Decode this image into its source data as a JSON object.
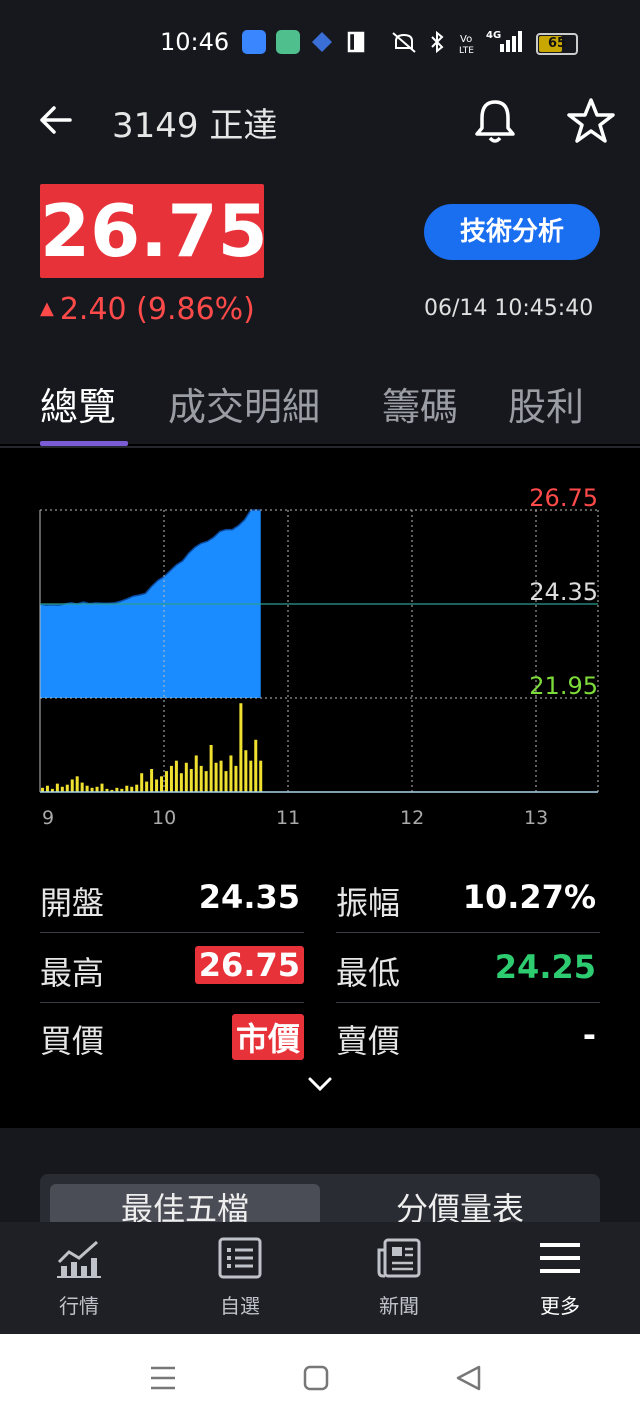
{
  "status_bar": {
    "time": "10:46",
    "battery": "65",
    "battery_level": 0.65,
    "icons": [
      "app-icon-android",
      "download-icon",
      "app-icon-diamond",
      "book-icon",
      "mute-icon",
      "bluetooth-icon",
      "volte-icon",
      "signal-4g-icon",
      "battery-icon"
    ]
  },
  "header": {
    "title": "3149 正達",
    "price": "26.75",
    "change": "2.40 (9.86%)",
    "change_arrow": "▲",
    "datetime": "06/14 10:45:40",
    "tech_button": "技術分析"
  },
  "tabs": [
    "總覽",
    "成交明細",
    "籌碼",
    "股利"
  ],
  "chart_data": {
    "type": "area",
    "y_labels": {
      "high": "26.75",
      "ref": "24.35",
      "low": "21.95"
    },
    "x_ticks": [
      "9",
      "10",
      "11",
      "12",
      "13"
    ],
    "ylim": [
      21.95,
      26.75
    ],
    "reference": 24.35,
    "price_series": {
      "x": [
        9.0,
        9.05,
        9.1,
        9.15,
        9.2,
        9.25,
        9.3,
        9.35,
        9.4,
        9.45,
        9.5,
        9.55,
        9.6,
        9.65,
        9.7,
        9.75,
        9.8,
        9.85,
        9.9,
        9.95,
        10.0,
        10.05,
        10.1,
        10.15,
        10.2,
        10.25,
        10.3,
        10.35,
        10.4,
        10.45,
        10.5,
        10.55,
        10.6,
        10.65,
        10.7,
        10.75,
        10.78
      ],
      "y": [
        24.35,
        24.32,
        24.33,
        24.32,
        24.35,
        24.38,
        24.35,
        24.4,
        24.36,
        24.38,
        24.37,
        24.37,
        24.38,
        24.42,
        24.48,
        24.55,
        24.58,
        24.62,
        24.8,
        24.95,
        25.05,
        25.2,
        25.35,
        25.45,
        25.65,
        25.8,
        25.9,
        25.95,
        26.05,
        26.2,
        26.25,
        26.25,
        26.35,
        26.5,
        26.75,
        26.75,
        26.75
      ]
    },
    "volume_series": {
      "x": [
        9.02,
        9.06,
        9.1,
        9.14,
        9.18,
        9.22,
        9.26,
        9.3,
        9.34,
        9.38,
        9.42,
        9.46,
        9.5,
        9.54,
        9.58,
        9.62,
        9.66,
        9.7,
        9.74,
        9.78,
        9.82,
        9.86,
        9.9,
        9.94,
        9.98,
        10.02,
        10.06,
        10.1,
        10.14,
        10.18,
        10.22,
        10.26,
        10.3,
        10.34,
        10.38,
        10.42,
        10.46,
        10.5,
        10.54,
        10.58,
        10.62,
        10.66,
        10.7,
        10.74,
        10.78
      ],
      "v": [
        4,
        6,
        3,
        8,
        5,
        7,
        12,
        15,
        9,
        6,
        4,
        5,
        8,
        3,
        2,
        4,
        3,
        6,
        5,
        7,
        18,
        10,
        22,
        12,
        15,
        20,
        25,
        30,
        18,
        28,
        22,
        35,
        25,
        20,
        45,
        28,
        30,
        20,
        35,
        25,
        85,
        40,
        30,
        50,
        30
      ]
    }
  },
  "stats": {
    "open_label": "開盤",
    "open": "24.35",
    "amp_label": "振幅",
    "amp": "10.27%",
    "high_label": "最高",
    "high": "26.75",
    "low_label": "最低",
    "low": "24.25",
    "bid_label": "買價",
    "bid": "市價",
    "ask_label": "賣價",
    "ask": "-"
  },
  "segment": {
    "best": "最佳五檔",
    "price_vol": "分價量表"
  },
  "bottom_nav": {
    "market": "行情",
    "watchlist": "自選",
    "news": "新聞",
    "more": "更多"
  },
  "colors": {
    "up": "#e8323a",
    "down": "#2ecc71",
    "accent": "#1a6ef0",
    "area": "#1a8cff",
    "volume": "#f0e030"
  }
}
